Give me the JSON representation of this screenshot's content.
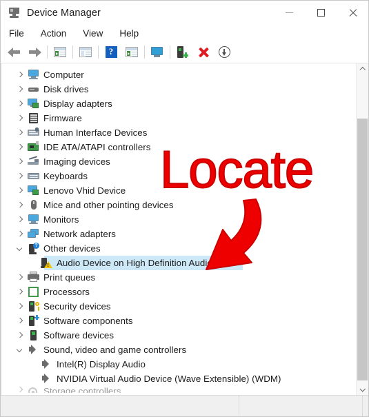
{
  "window": {
    "title": "Device Manager",
    "icon": "device-manager-icon",
    "controls": {
      "minimize": "–",
      "maximize": "□",
      "close": "✕"
    }
  },
  "menubar": {
    "items": [
      {
        "label": "File"
      },
      {
        "label": "Action"
      },
      {
        "label": "View"
      },
      {
        "label": "Help"
      }
    ]
  },
  "toolbar": {
    "buttons": [
      {
        "name": "back-button",
        "icon": "back-arrow-icon"
      },
      {
        "name": "forward-button",
        "icon": "forward-arrow-icon"
      },
      {
        "name": "show-hide-console-tree-button",
        "icon": "console-tree-icon"
      },
      {
        "name": "properties-button",
        "icon": "properties-icon"
      },
      {
        "name": "help-button",
        "icon": "help-question-icon"
      },
      {
        "name": "update-driver-button",
        "icon": "update-driver-icon"
      },
      {
        "name": "scan-monitor-button",
        "icon": "monitor-icon"
      },
      {
        "name": "scan-for-hardware-changes-button",
        "icon": "scan-hardware-icon"
      },
      {
        "name": "uninstall-device-button",
        "icon": "red-x-icon"
      },
      {
        "name": "disable-device-button",
        "icon": "down-arrow-circle-icon"
      }
    ]
  },
  "tree": {
    "items": [
      {
        "label": "Computer",
        "icon": "computer-icon",
        "state": "collapsed",
        "level": 1,
        "selected": false
      },
      {
        "label": "Disk drives",
        "icon": "disk-drive-icon",
        "state": "collapsed",
        "level": 1,
        "selected": false
      },
      {
        "label": "Display adapters",
        "icon": "display-adapter-icon",
        "state": "collapsed",
        "level": 1,
        "selected": false
      },
      {
        "label": "Firmware",
        "icon": "firmware-icon",
        "state": "collapsed",
        "level": 1,
        "selected": false
      },
      {
        "label": "Human Interface Devices",
        "icon": "hid-icon",
        "state": "collapsed",
        "level": 1,
        "selected": false
      },
      {
        "label": "IDE ATA/ATAPI controllers",
        "icon": "ide-controller-icon",
        "state": "collapsed",
        "level": 1,
        "selected": false
      },
      {
        "label": "Imaging devices",
        "icon": "imaging-device-icon",
        "state": "collapsed",
        "level": 1,
        "selected": false
      },
      {
        "label": "Keyboards",
        "icon": "keyboard-icon",
        "state": "collapsed",
        "level": 1,
        "selected": false
      },
      {
        "label": "Lenovo Vhid Device",
        "icon": "lenovo-vhid-icon",
        "state": "collapsed",
        "level": 1,
        "selected": false
      },
      {
        "label": "Mice and other pointing devices",
        "icon": "mouse-icon",
        "state": "collapsed",
        "level": 1,
        "selected": false
      },
      {
        "label": "Monitors",
        "icon": "monitor-icon",
        "state": "collapsed",
        "level": 1,
        "selected": false
      },
      {
        "label": "Network adapters",
        "icon": "network-adapter-icon",
        "state": "collapsed",
        "level": 1,
        "selected": false
      },
      {
        "label": "Other devices",
        "icon": "other-devices-icon",
        "state": "expanded",
        "level": 1,
        "selected": false
      },
      {
        "label": "Audio Device on High Definition Audio Bus",
        "icon": "warning-device-icon",
        "state": "leaf",
        "level": 2,
        "selected": true
      },
      {
        "label": "Print queues",
        "icon": "printer-icon",
        "state": "collapsed",
        "level": 1,
        "selected": false
      },
      {
        "label": "Processors",
        "icon": "processor-icon",
        "state": "collapsed",
        "level": 1,
        "selected": false
      },
      {
        "label": "Security devices",
        "icon": "security-device-icon",
        "state": "collapsed",
        "level": 1,
        "selected": false
      },
      {
        "label": "Software components",
        "icon": "software-component-icon",
        "state": "collapsed",
        "level": 1,
        "selected": false
      },
      {
        "label": "Software devices",
        "icon": "software-device-icon",
        "state": "collapsed",
        "level": 1,
        "selected": false
      },
      {
        "label": "Sound, video and game controllers",
        "icon": "speaker-icon",
        "state": "expanded",
        "level": 1,
        "selected": false
      },
      {
        "label": "Intel(R) Display Audio",
        "icon": "speaker-icon",
        "state": "leaf",
        "level": 2,
        "selected": false
      },
      {
        "label": "NVIDIA Virtual Audio Device (Wave Extensible) (WDM)",
        "icon": "speaker-icon",
        "state": "leaf",
        "level": 2,
        "selected": false
      },
      {
        "label": "Storage controllers",
        "icon": "storage-controller-icon",
        "state": "collapsed",
        "level": 1,
        "selected": false
      }
    ]
  },
  "annotation": {
    "text": "Locate",
    "color": "#ee0000",
    "outline_color": "#cc0000",
    "arrow": "curved-red-arrow-pointing-down-left"
  },
  "statusbar": {
    "panel1": "",
    "panel2": "",
    "panel3": ""
  },
  "scrollbar": {
    "up_arrow": "scroll-up-arrow",
    "down_arrow": "scroll-down-arrow"
  }
}
